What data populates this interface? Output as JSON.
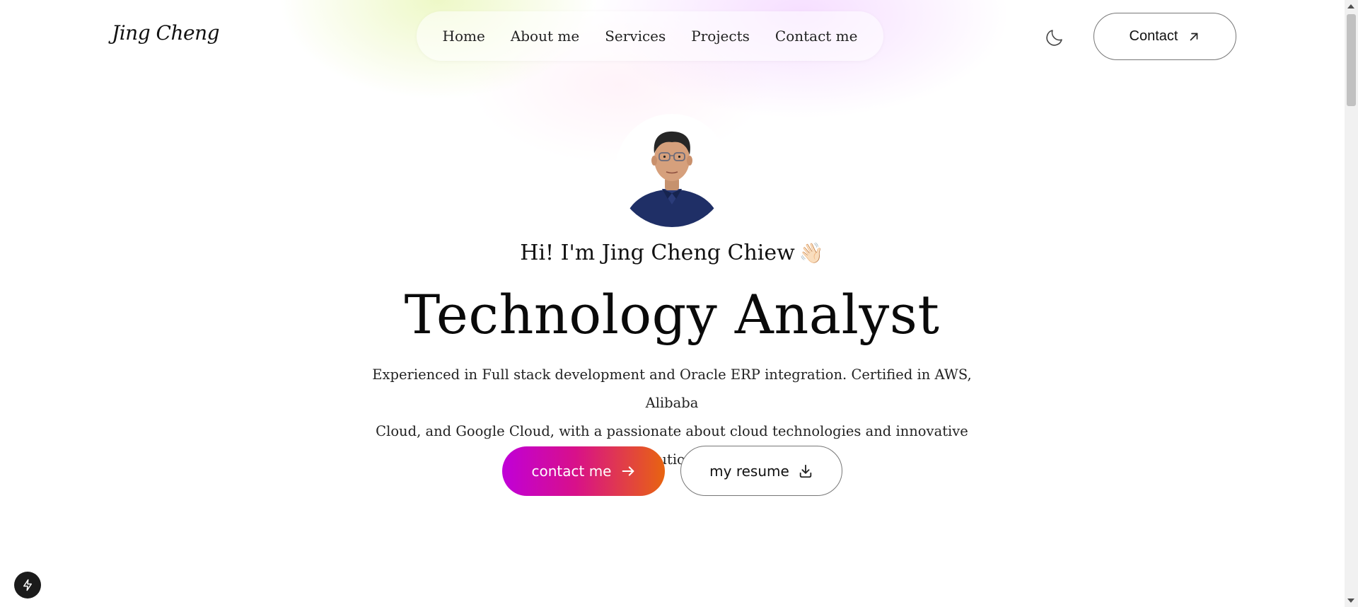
{
  "brand": {
    "logo_text": "Jing Cheng"
  },
  "nav": {
    "items": [
      {
        "label": "Home"
      },
      {
        "label": "About me"
      },
      {
        "label": "Services"
      },
      {
        "label": "Projects"
      },
      {
        "label": "Contact me"
      }
    ]
  },
  "header": {
    "theme_toggle_icon": "moon-icon",
    "contact_button_label": "Contact",
    "contact_button_icon": "arrow-up-right-icon"
  },
  "hero": {
    "greeting": "Hi! I'm Jing Cheng Chiew",
    "greeting_emoji": "👋🏻",
    "headline": "Technology Analyst",
    "intro_line1": "Experienced in Full stack development and Oracle ERP integration. Certified in AWS, Alibaba",
    "intro_line2": "Cloud, and Google Cloud, with a passionate about cloud technologies and innovative solutions.",
    "cta_contact_label": "contact me",
    "cta_resume_label": "my resume"
  },
  "colors": {
    "cta_gradient_start": "#c000d8",
    "cta_gradient_mid": "#d8108a",
    "cta_gradient_end": "#e86410"
  }
}
